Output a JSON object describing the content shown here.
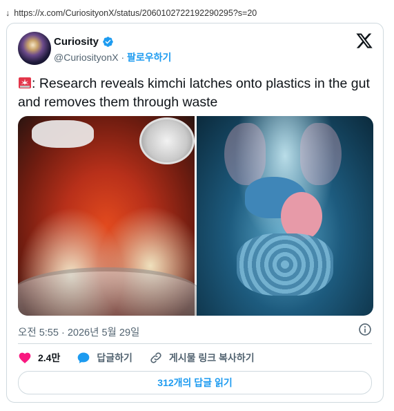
{
  "browser": {
    "url": "https://x.com/CuriosityonX/status/2060102722192290295?s=20"
  },
  "tweet": {
    "author_name": "Curiosity",
    "handle": "@CuriosityonX",
    "separator": " · ",
    "follow_label": "팔로우하기",
    "text": ": Research reveals kimchi latches onto plastics in the gut and removes them through waste",
    "timestamp": "오전 5:55 · 2026년 5월 29일",
    "likes": "2.4만",
    "reply_label": "답글하기",
    "copy_link_label": "게시물 링크 복사하기",
    "read_replies_label": "312개의 답글 읽기"
  },
  "colors": {
    "accent": "#1d9bf0",
    "like": "#f91880",
    "muted": "#536471",
    "border": "#cfd9de"
  }
}
